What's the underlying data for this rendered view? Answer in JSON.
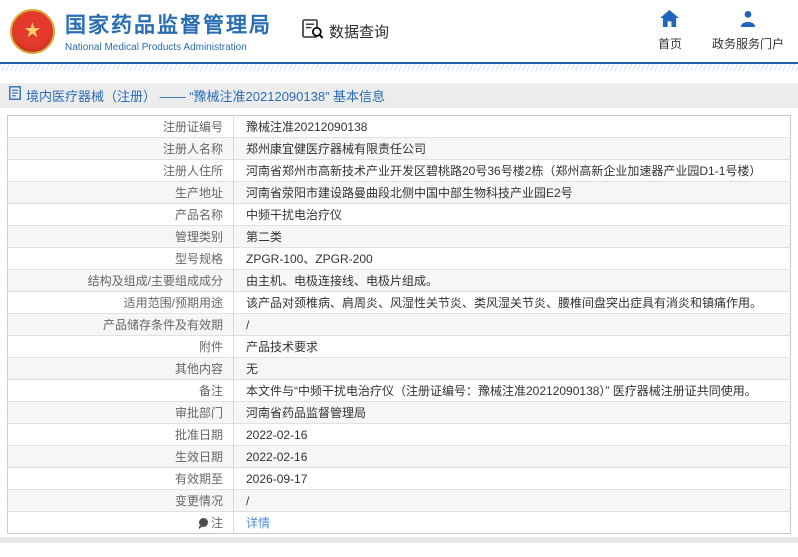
{
  "colors": {
    "accent_blue": "#2a6db5",
    "icon_blue": "#1f66c0",
    "link_blue": "#4a90d9",
    "header_rule_blue": "#1c5fa8",
    "bar_gray": "#ececec",
    "row_alt_gray": "#f6f6f6"
  },
  "header": {
    "title_cn": "国家药品监督管理局",
    "title_en": "National Medical Products Administration",
    "data_query_label": "数据查询",
    "nav": [
      {
        "label": "首页",
        "icon": "home-icon"
      },
      {
        "label": "政务服务门户",
        "icon": "user-icon"
      }
    ]
  },
  "breadcrumb": {
    "text": "境内医疗器械（注册） —— “豫械注准20212090138” 基本信息"
  },
  "table": {
    "rows": [
      {
        "label": "注册证编号",
        "value": "豫械注准20212090138"
      },
      {
        "label": "注册人名称",
        "value": "郑州康宜健医疗器械有限责任公司"
      },
      {
        "label": "注册人住所",
        "value": "河南省郑州市高新技术产业开发区碧桃路20号36号楼2栋（郑州高新企业加速器产业园D1-1号楼）"
      },
      {
        "label": "生产地址",
        "value": "河南省荥阳市建设路曼曲段北侧中国中部生物科技产业园E2号"
      },
      {
        "label": "产品名称",
        "value": "中频干扰电治疗仪"
      },
      {
        "label": "管理类别",
        "value": "第二类"
      },
      {
        "label": "型号规格",
        "value": "ZPGR-100、ZPGR-200"
      },
      {
        "label": "结构及组成/主要组成成分",
        "value": "由主机、电极连接线、电极片组成。"
      },
      {
        "label": "适用范围/预期用途",
        "value": "该产品对颈椎病、肩周炎、风湿性关节炎、类风湿关节炎、腰椎间盘突出症具有消炎和镇痛作用。"
      },
      {
        "label": "产品储存条件及有效期",
        "value": "/"
      },
      {
        "label": "附件",
        "value": "产品技术要求"
      },
      {
        "label": "其他内容",
        "value": "无"
      },
      {
        "label": "备注",
        "value": "本文件与“中频干扰电治疗仪（注册证编号：豫械注准20212090138）” 医疗器械注册证共同使用。"
      },
      {
        "label": "审批部门",
        "value": "河南省药品监督管理局"
      },
      {
        "label": "批准日期",
        "value": "2022-02-16"
      },
      {
        "label": "生效日期",
        "value": "2022-02-16"
      },
      {
        "label": "有效期至",
        "value": "2026-09-17"
      },
      {
        "label": "变更情况",
        "value": "/"
      },
      {
        "label": "注",
        "value": "详情",
        "label_icon": "note-icon",
        "value_is_link": true
      }
    ]
  }
}
